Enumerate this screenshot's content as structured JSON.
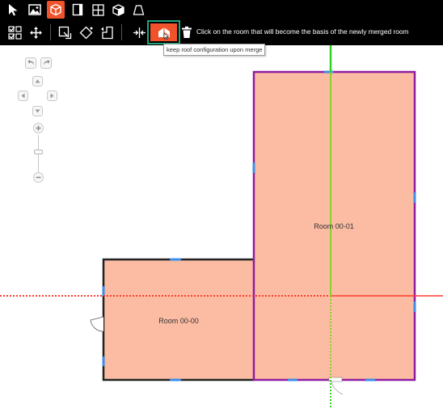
{
  "toolbar_top": {
    "tools": [
      {
        "name": "select-tool",
        "icon": "cursor-arrow-icon",
        "active": false
      },
      {
        "name": "image-tool",
        "icon": "picture-icon",
        "active": false
      },
      {
        "name": "room-3d-tool",
        "icon": "cube-icon",
        "active": true
      },
      {
        "name": "door-tool",
        "icon": "door-icon",
        "active": false
      },
      {
        "name": "window-tool",
        "icon": "window-grid-icon",
        "active": false
      },
      {
        "name": "object-tool",
        "icon": "box-icon",
        "active": false
      },
      {
        "name": "roof-tool",
        "icon": "trapezoid-icon",
        "active": false
      }
    ]
  },
  "toolbar_sub": {
    "status_text": "Click on the room that will become the basis of the newly merged room",
    "tooltip": "keep roof configuration upon merge",
    "tools": [
      {
        "name": "multi-select",
        "icon": "checkbox-grid-icon"
      },
      {
        "name": "move",
        "icon": "move-arrows-icon"
      },
      {
        "name": "resize-room",
        "icon": "resize-square-icon"
      },
      {
        "name": "rotate-room",
        "icon": "diamond-icon"
      },
      {
        "name": "l-shape-room",
        "icon": "l-shape-icon"
      },
      {
        "name": "merge-rooms",
        "icon": "merge-arrows-icon"
      },
      {
        "name": "keep-roof",
        "icon": "roof-merge-icon",
        "active": true
      },
      {
        "name": "delete-room",
        "icon": "trash-icon"
      }
    ]
  },
  "rooms": [
    {
      "label": "Room 00-00"
    },
    {
      "label": "Room 00-01"
    }
  ],
  "colors": {
    "accent": "#f0522b",
    "active_outline": "#1fa57e",
    "room_fill": "#fbbca3",
    "selected_wall": "#8e1da1",
    "wall": "#222222",
    "opening": "#3d8ee8",
    "axis_x": "#ff3b30",
    "axis_y": "#7ed321"
  }
}
